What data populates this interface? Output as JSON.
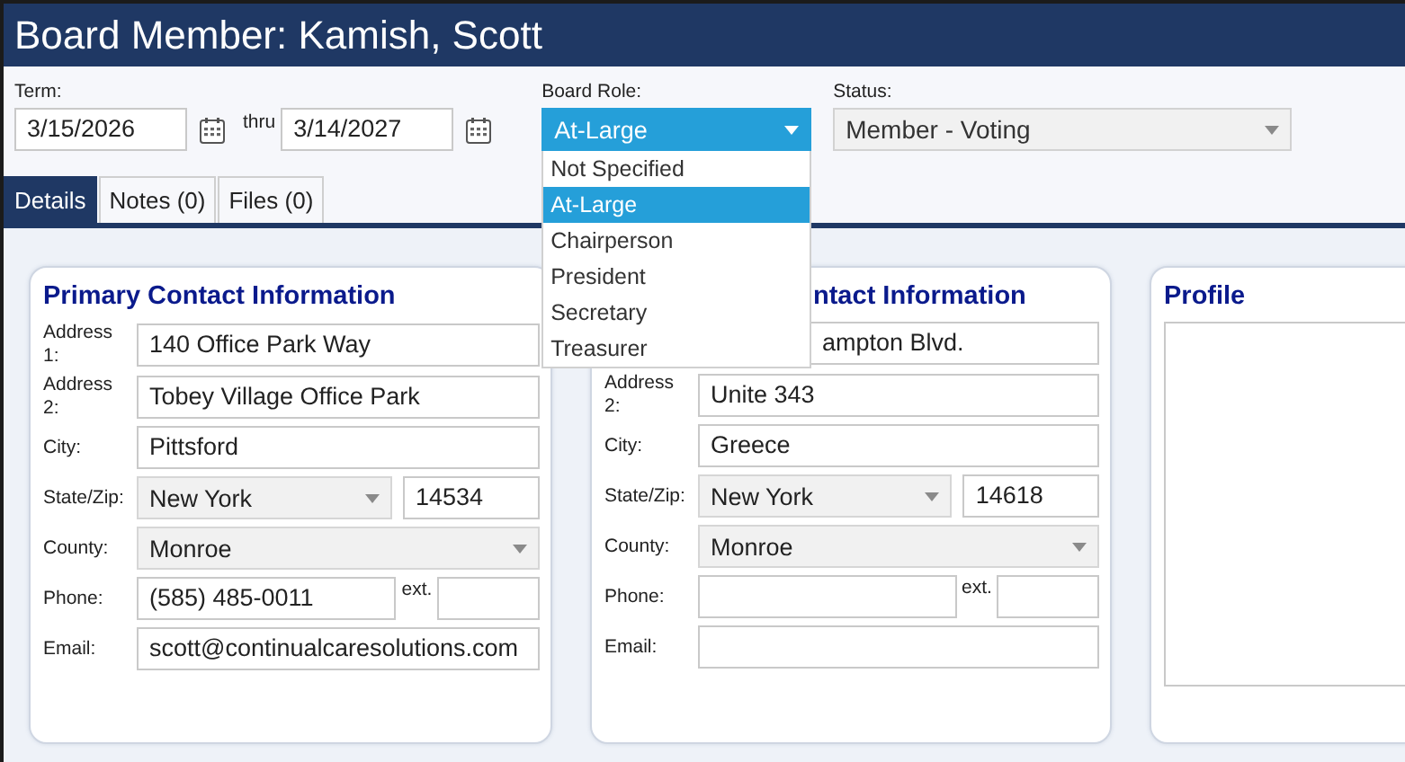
{
  "window": {
    "title": "Board Member: Kamish, Scott"
  },
  "term": {
    "label": "Term:",
    "start": "3/15/2026",
    "thru_label": "thru",
    "end": "3/14/2027"
  },
  "board_role": {
    "label": "Board Role:",
    "value": "At-Large",
    "expanded": true,
    "options": [
      {
        "label": "Not Specified",
        "selected": false
      },
      {
        "label": "At-Large",
        "selected": true
      },
      {
        "label": "Chairperson",
        "selected": false
      },
      {
        "label": "President",
        "selected": false
      },
      {
        "label": "Secretary",
        "selected": false
      },
      {
        "label": "Treasurer",
        "selected": false
      }
    ]
  },
  "status": {
    "label": "Status:",
    "value": "Member - Voting"
  },
  "tabs": [
    {
      "label": "Details",
      "selected": true
    },
    {
      "label": "Notes (0)",
      "selected": false
    },
    {
      "label": "Files (0)",
      "selected": false
    }
  ],
  "cards": [
    {
      "kind": "contact",
      "title": "Primary Contact Information",
      "rows": [
        {
          "kind": "text",
          "label": "Address 1:",
          "value": "140 Office Park Way"
        },
        {
          "kind": "text",
          "label": "Address 2:",
          "value": "Tobey Village Office Park"
        },
        {
          "kind": "text",
          "label": "City:",
          "value": "Pittsford"
        },
        {
          "kind": "state_zip",
          "label": "State/Zip:",
          "value": "New York",
          "zip": "14534"
        },
        {
          "kind": "select",
          "label": "County:",
          "value": "Monroe"
        },
        {
          "kind": "phone",
          "label": "Phone:",
          "value": "(585) 485-0011",
          "ext_label": "ext."
        },
        {
          "kind": "text",
          "label": "Email:",
          "value": "scott@continualcaresolutions.com"
        }
      ]
    },
    {
      "kind": "contact",
      "title": "ntact Information",
      "rows": [
        {
          "kind": "text",
          "value": "ampton Blvd."
        },
        {
          "kind": "text",
          "label": "Address 2:",
          "value": "Unite 343"
        },
        {
          "kind": "text",
          "label": "City:",
          "value": "Greece"
        },
        {
          "kind": "state_zip",
          "label": "State/Zip:",
          "value": "New York",
          "zip": "14618"
        },
        {
          "kind": "select",
          "label": "County:",
          "value": "Monroe"
        },
        {
          "kind": "phone",
          "label": "Phone:",
          "ext_label": "ext."
        },
        {
          "kind": "text",
          "label": "Email:"
        }
      ]
    },
    {
      "kind": "profile",
      "title": "Profile"
    }
  ]
}
